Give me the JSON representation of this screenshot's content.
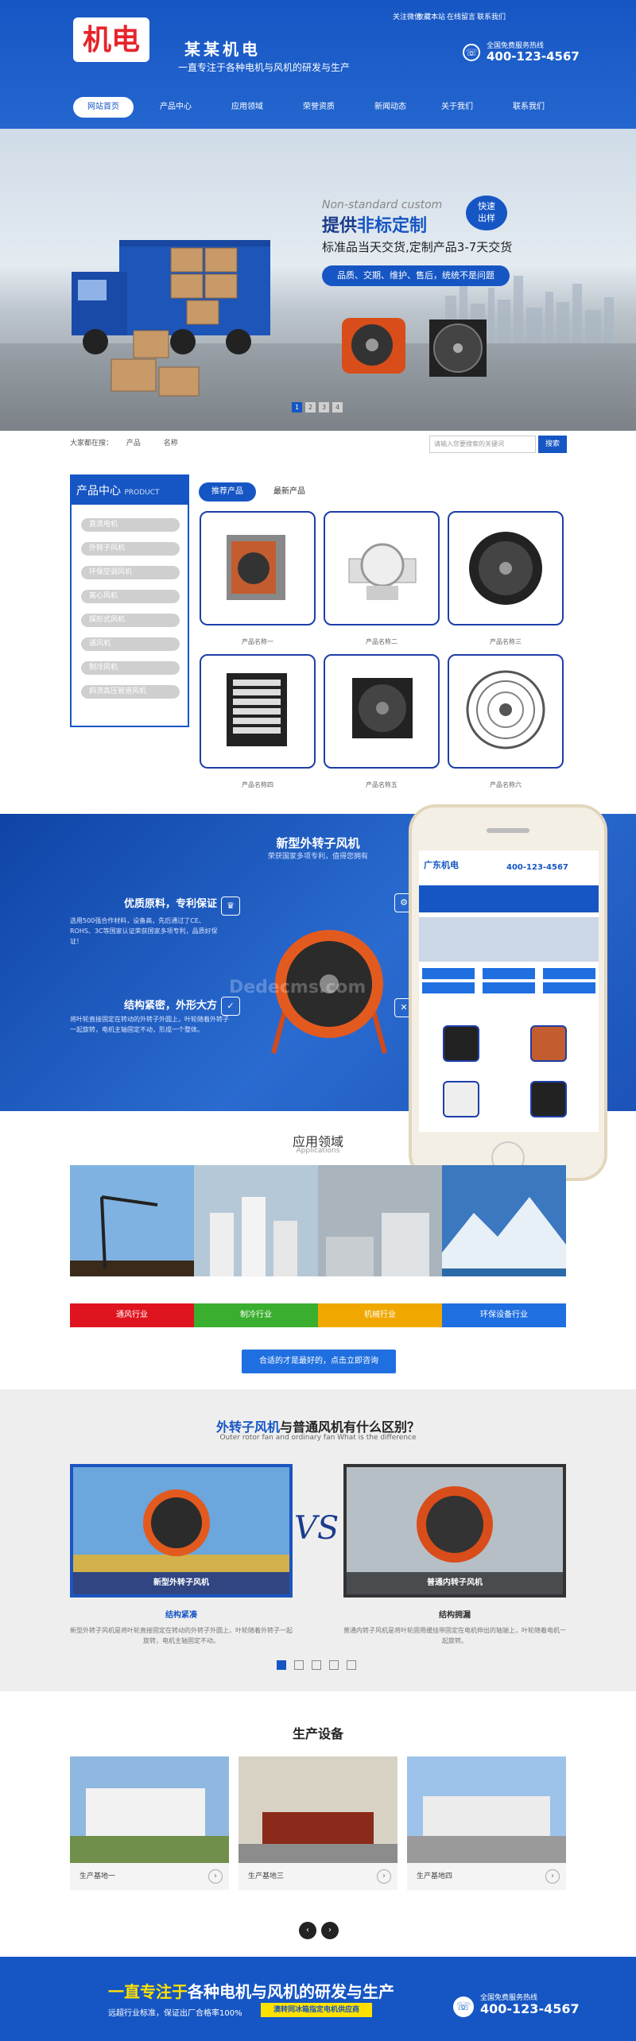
{
  "header": {
    "logo_text": "机电",
    "brand": "某某机电",
    "slogan": "一直专注于各种电机与风机的研发与生产",
    "top_links": [
      "关注微信",
      "收藏本站",
      "在线留言",
      "联系我们"
    ],
    "hotline_label": "全国免费服务热线",
    "hotline": "400-123-4567"
  },
  "nav": [
    "网站首页",
    "产品中心",
    "应用领域",
    "荣誉资质",
    "新闻动态",
    "关于我们",
    "联系我们"
  ],
  "banner": {
    "en": "Non-standard custom",
    "title_a": "提供",
    "title_b": "非标定制",
    "subtitle": "标准品当天交货,定制产品3-7天交货",
    "bar": "品质、交期、维护、售后，统统不是问题",
    "badge_line1": "快速",
    "badge_line2": "出样",
    "dots": [
      "1",
      "2",
      "3",
      "4"
    ]
  },
  "breadcrumb": {
    "label": "大家都在搜：",
    "items": [
      "产品",
      "名称"
    ]
  },
  "search": {
    "placeholder": "请输入您要搜索的关键词",
    "button": "搜索"
  },
  "products": {
    "sidebar_title": "产品中心",
    "sidebar_en": "PRODUCT",
    "categories": [
      "直流电机",
      "外转子风机",
      "环保空调风机",
      "离心风机",
      "採形式风机",
      "通风机",
      "制冷风机",
      "斜流高压管道风机"
    ],
    "tabs": [
      "推荐产品",
      "最新产品"
    ],
    "items": [
      "产品名称一",
      "产品名称二",
      "产品名称三",
      "产品名称四",
      "产品名称五",
      "产品名称六"
    ]
  },
  "feature": {
    "title": "新型外转子风机",
    "subtitle": "荣获国家多项专利，值得您拥有",
    "block1_title": "优质原料，专利保证",
    "block1_text": "选用500强合作材料，设备高，先后通过了CE、ROHS、3C等国家认证荣获国家多项专利，品质好保证！",
    "block2_title": "结构紧密，外形大方",
    "block2_text": "将叶轮直接固定在转动的外转子外圆上，叶轮随着外转子一起旋转，电机主轴固定不动，形成一个整体。",
    "watermark": "Dedecms.com"
  },
  "phone_mock": {
    "brand": "广东机电",
    "hotline": "400-123-4567"
  },
  "application": {
    "title": "应用领域",
    "en": "Applications",
    "items": [
      "通风行业",
      "制冷行业",
      "机械行业",
      "环保设备行业"
    ],
    "colors": [
      "#e0141e",
      "#3aae2e",
      "#f0a800",
      "#1f6fe0"
    ],
    "button": "合适的才是最好的，点击立即咨询"
  },
  "compare": {
    "title_a": "外转子风机",
    "title_b": "与普通风机有什么区别？",
    "en": "Outer rotor fan and ordinary fan What is the difference",
    "vs": "VS",
    "left_label": "新型外转子风机",
    "right_label": "普通内转子风机",
    "left_caption": "结构紧凑",
    "right_caption": "结构拥漏",
    "left_text": "新型外转子风机是将叶轮直接固定在转动的外转子外圆上，叶轮随着外转子一起旋转，电机主轴固定不动。",
    "right_text": "普通内转子风机是将叶轮固用缓挂带固定在电机伸出的轴端上，叶轮随着电机一起旋转。",
    "dots": 5
  },
  "production": {
    "title": "生产设备",
    "items": [
      "生产基地一",
      "生产基地三",
      "生产基地四"
    ]
  },
  "footer": {
    "main_a": "一直专注于",
    "main_b": "各种电机与风机的研发与生产",
    "left": "远超行业标准，保证出厂合格率100%",
    "badge": "澳转同冰箱指定电机供应商",
    "hotline_label": "全国免费服务热线",
    "hotline": "400-123-4567"
  }
}
